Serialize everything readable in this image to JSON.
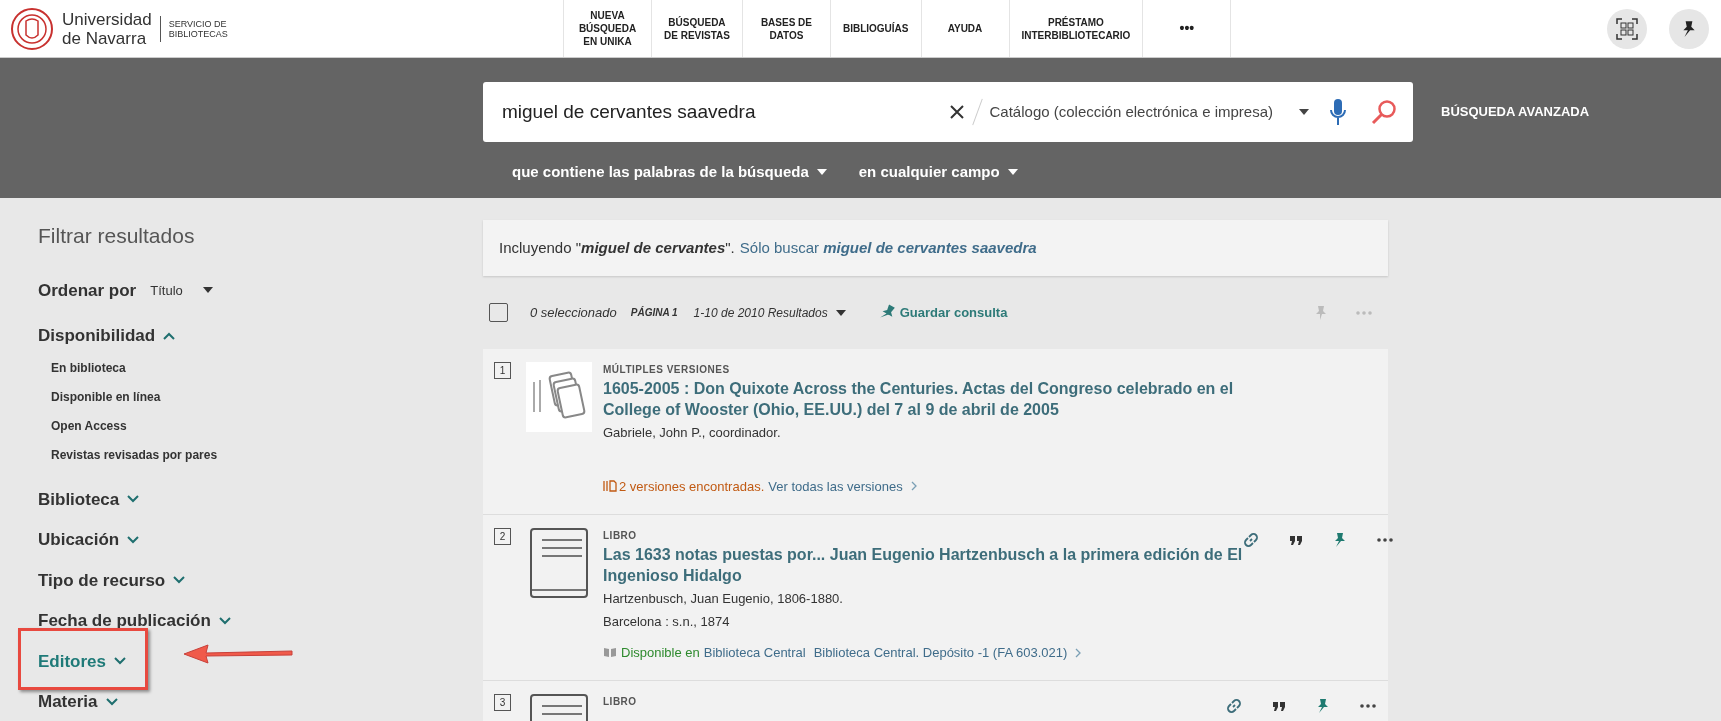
{
  "header": {
    "logo_lines": [
      "Universidad",
      "de Navarra"
    ],
    "service_lines": [
      "SERVICIO DE",
      "BIBLIOTECAS"
    ],
    "nav": [
      {
        "lines": [
          "NUEVA",
          "BÚSQUEDA",
          "EN UNIKA"
        ]
      },
      {
        "lines": [
          "BÚSQUEDA",
          "DE REVISTAS"
        ]
      },
      {
        "lines": [
          "BASES DE",
          "DATOS"
        ]
      },
      {
        "lines": [
          "BIBLIOGUÍAS"
        ]
      },
      {
        "lines": [
          "AYUDA"
        ]
      },
      {
        "lines": [
          "PRÉSTAMO",
          "INTERBIBLIOTECARIO"
        ]
      },
      {
        "lines": [
          "•••"
        ]
      }
    ]
  },
  "search": {
    "value": "miguel de cervantes saavedra",
    "scope": "Catálogo (colección electrónica e impresa)",
    "advanced": "BÚSQUEDA AVANZADA",
    "options": [
      "que contiene las palabras de la búsqueda",
      "en cualquier campo"
    ]
  },
  "sidebar": {
    "title": "Filtrar resultados",
    "sort_label": "Ordenar por",
    "sort_value": "Título",
    "facets": [
      {
        "label": "Disponibilidad",
        "expanded": true,
        "highlighted": false,
        "children": [
          "En biblioteca",
          "Disponible en línea",
          "Open Access",
          "Revistas revisadas por pares"
        ]
      },
      {
        "label": "Biblioteca",
        "expanded": false,
        "highlighted": false
      },
      {
        "label": "Ubicación",
        "expanded": false,
        "highlighted": false
      },
      {
        "label": "Tipo de recurso",
        "expanded": false,
        "highlighted": false
      },
      {
        "label": "Fecha de publicación",
        "expanded": false,
        "highlighted": false
      },
      {
        "label": "Editores",
        "expanded": false,
        "highlighted": true
      },
      {
        "label": "Materia",
        "expanded": false,
        "highlighted": false
      }
    ]
  },
  "banner": {
    "text": "Incluyendo \"*miguel de cervantes*\".",
    "link": "Sólo buscar *miguel de cervantes saavedra*"
  },
  "toolbar": {
    "checked": false,
    "selected": "0 seleccionado",
    "page": "PÁGINA 1",
    "range": "1-10 de 2010 Resultados",
    "save": "Guardar consulta"
  },
  "results": [
    {
      "number": "1",
      "type": "MÚLTIPLES VERSIONES",
      "thumbnail": {
        "kind": "multiple"
      },
      "actions": false,
      "title": "1605-2005 : Don Quixote Across the Centuries. Actas del Congreso celebrado en el College of Wooster (Ohio, EE.UU.) del 7 al 9 de abril de 2005",
      "details": [
        "Gabriele, John P., coordinador."
      ],
      "kind": "versions",
      "status": "2 versiones encontradas.",
      "link": "Ver todas las versiones"
    },
    {
      "number": "2",
      "type": "LIBRO",
      "thumbnail": {
        "kind": "book"
      },
      "actions": true,
      "title": "Las 1633 notas puestas por... Juan Eugenio Hartzenbusch a la primera edición de El Ingenioso Hidalgo",
      "details": [
        "Hartzenbusch, Juan Eugenio, 1806-1880.",
        "Barcelona : s.n., 1874"
      ],
      "kind": "availability",
      "status": "Disponible en",
      "library": "Biblioteca Central",
      "link": "Biblioteca Central. Depósito -1 (FA 603.021)"
    },
    {
      "number": "3",
      "type": "LIBRO",
      "thumbnail": {
        "kind": "book"
      },
      "actions": true
    }
  ]
}
